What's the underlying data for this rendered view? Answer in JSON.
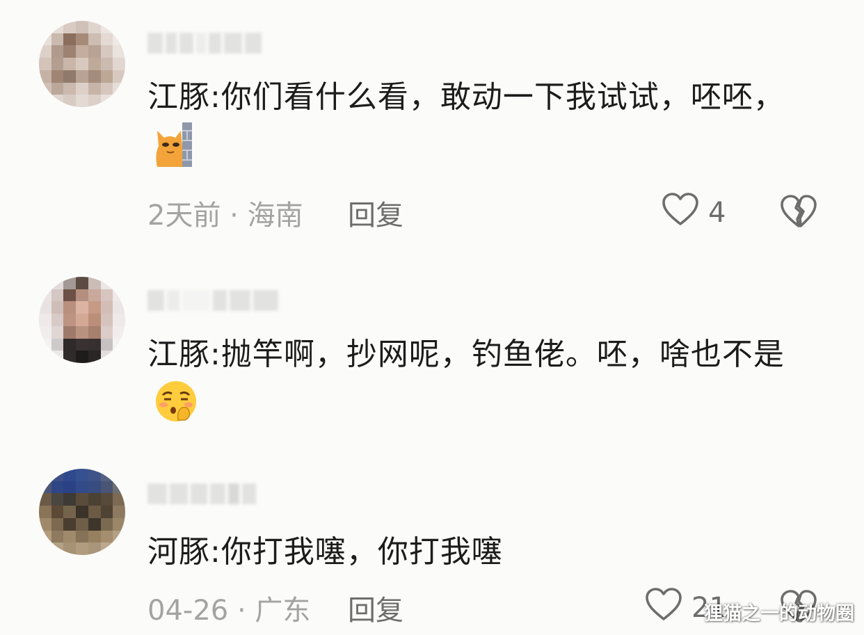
{
  "comments": [
    {
      "text": "江豚:你们看什么看，敢动一下我试试，呸呸，",
      "emoji": "cat-wall-peek-icon",
      "meta": "2天前 · 海南",
      "reply_label": "回复",
      "like_count": "4"
    },
    {
      "text": "江豚:抛竿啊，抄网呢，钓鱼佬。呸，啥也不是",
      "emoji": "shush-face-icon",
      "meta": "",
      "reply_label": "",
      "like_count": ""
    },
    {
      "text": "河豚:你打我噻，你打我噻",
      "emoji": "",
      "meta": "04-26 · 广东",
      "reply_label": "回复",
      "like_count": "21"
    }
  ],
  "watermark": "狸猫之一的动物圈",
  "colors": {
    "text": "#1c1c1c",
    "meta": "#a3a3a3",
    "action": "#6d6d6d",
    "background": "#fbfbf9"
  }
}
